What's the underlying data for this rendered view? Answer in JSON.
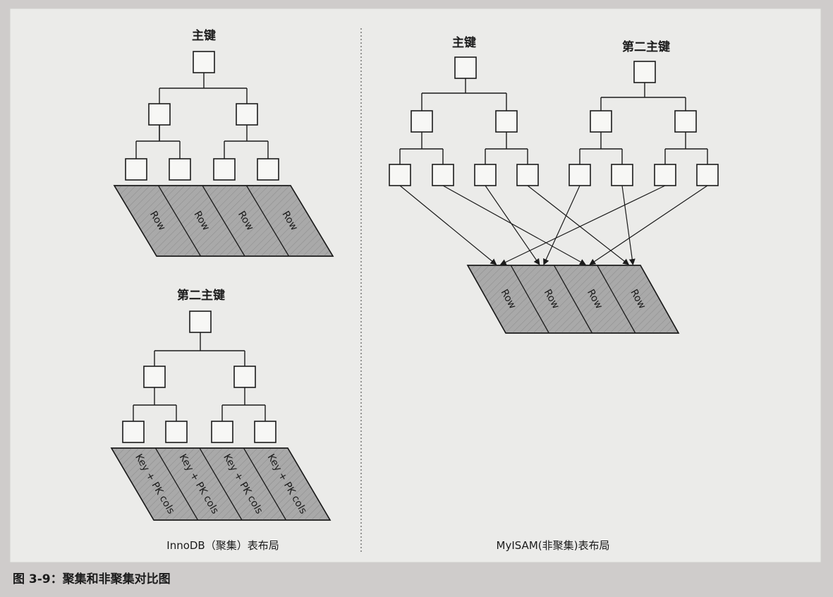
{
  "figure": {
    "caption": "图 3-9：聚集和非聚集对比图",
    "background": "#cfcccb",
    "panel_fill": "#ebebe9",
    "slab_fill": "#a9a9a9"
  },
  "innodb": {
    "caption": "InnoDB（聚集）表布局",
    "primary_tree": {
      "title": "主键",
      "leaf_labels": [
        "Row",
        "Row",
        "Row",
        "Row"
      ]
    },
    "secondary_tree": {
      "title": "第二主键",
      "leaf_labels": [
        "Key + PK cols",
        "Key + PK cols",
        "Key + PK cols",
        "Key + PK cols"
      ]
    }
  },
  "myisam": {
    "caption": "MyISAM(非聚集)表布局",
    "primary_tree": {
      "title": "主键"
    },
    "secondary_tree": {
      "title": "第二主键"
    },
    "row_labels": [
      "Row",
      "Row",
      "Row",
      "Row"
    ],
    "pointers": {
      "primary": [
        0,
        2,
        1,
        3
      ],
      "secondary": [
        1,
        3,
        0,
        2
      ]
    }
  }
}
